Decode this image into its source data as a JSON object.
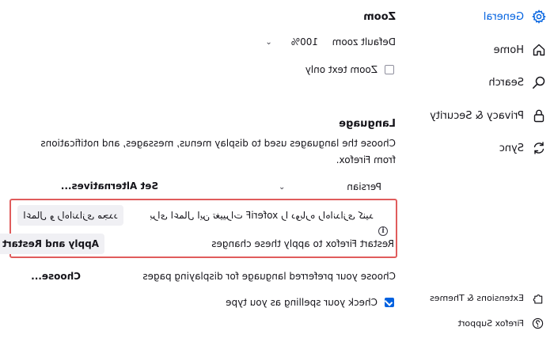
{
  "sidebar": {
    "items": [
      {
        "label": "General",
        "icon": "gear-icon",
        "active": true
      },
      {
        "label": "Home",
        "icon": "home-icon",
        "active": false
      },
      {
        "label": "Search",
        "icon": "search-icon",
        "active": false
      },
      {
        "label": "Privacy & Security",
        "icon": "lock-icon",
        "active": false
      },
      {
        "label": "Sync",
        "icon": "sync-icon",
        "active": false
      }
    ],
    "footer": [
      {
        "label": "Extensions & Themes",
        "icon": "puzzle-icon"
      },
      {
        "label": "Firefox Support",
        "icon": "help-icon"
      }
    ]
  },
  "zoom": {
    "heading": "Zoom",
    "default_label": "Default zoom",
    "default_value": "100%",
    "text_only_label": "Zoom text only",
    "text_only_checked": false
  },
  "language": {
    "heading": "Language",
    "description": "Choose the languages used to display menus, messages, and notifications from Firefox.",
    "selected": "Persian",
    "set_alternatives_label": "Set Alternatives...",
    "notice_rtl": "برای اعمال این تغییرات Firefox را دوباره راه‌اندازی کنید",
    "notice_en": "Restart Firefox to apply these changes",
    "apply_rtl_label": "اعمال و راه‌اندازی مجدد",
    "apply_en_label": "Apply and Restart",
    "pages_label": "Choose your preferred language for displaying pages",
    "choose_label": "Choose...",
    "spell_label": "Check your spelling as you type",
    "spell_checked": true
  },
  "colors": {
    "accent": "#0061e0",
    "highlight_border": "#e05c5c",
    "button_bg": "#f0f0f4"
  }
}
